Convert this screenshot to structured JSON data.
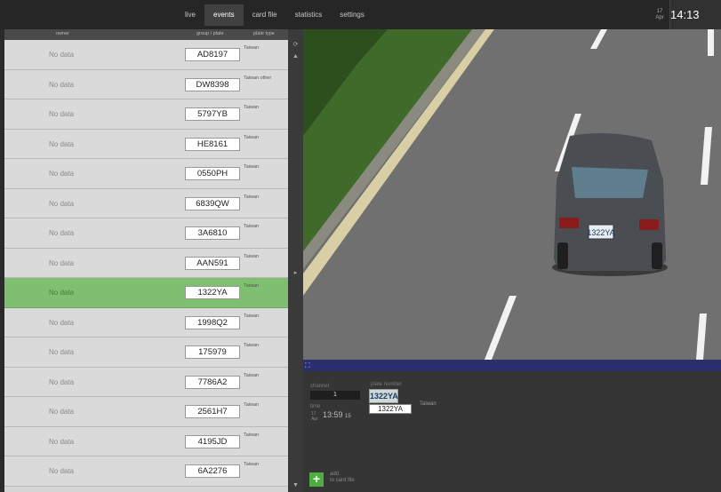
{
  "nav": {
    "tabs": [
      {
        "label": "live",
        "active": false
      },
      {
        "label": "events",
        "active": true
      },
      {
        "label": "card file",
        "active": false
      },
      {
        "label": "statistics",
        "active": false
      },
      {
        "label": "settings",
        "active": false
      }
    ]
  },
  "clock": {
    "day": "17",
    "month": "Apr",
    "time": "14:13"
  },
  "table": {
    "headers": {
      "owner": "owner",
      "group": "group / plate",
      "type": "plate type"
    },
    "rows": [
      {
        "owner": "No data",
        "plate": "AD8197",
        "type": "Taiwan",
        "selected": false
      },
      {
        "owner": "No data",
        "plate": "DW8398",
        "type": "Taiwan other",
        "selected": false
      },
      {
        "owner": "No data",
        "plate": "5797YB",
        "type": "Taiwan",
        "selected": false
      },
      {
        "owner": "No data",
        "plate": "HE8161",
        "type": "Taiwan",
        "selected": false
      },
      {
        "owner": "No data",
        "plate": "0550PH",
        "type": "Taiwan",
        "selected": false
      },
      {
        "owner": "No data",
        "plate": "6839QW",
        "type": "Taiwan",
        "selected": false
      },
      {
        "owner": "No data",
        "plate": "3A6810",
        "type": "Taiwan",
        "selected": false
      },
      {
        "owner": "No data",
        "plate": "AAN591",
        "type": "Taiwan",
        "selected": false
      },
      {
        "owner": "No data",
        "plate": "1322YA",
        "type": "Taiwan",
        "selected": true
      },
      {
        "owner": "No data",
        "plate": "1998Q2",
        "type": "Taiwan",
        "selected": false
      },
      {
        "owner": "No data",
        "plate": "175979",
        "type": "Taiwan",
        "selected": false
      },
      {
        "owner": "No data",
        "plate": "7786A2",
        "type": "Taiwan",
        "selected": false
      },
      {
        "owner": "No data",
        "plate": "2561H7",
        "type": "Taiwan",
        "selected": false
      },
      {
        "owner": "No data",
        "plate": "4195JD",
        "type": "Taiwan",
        "selected": false
      },
      {
        "owner": "No data",
        "plate": "6A2276",
        "type": "Taiwan",
        "selected": false
      }
    ]
  },
  "details": {
    "channel_label": "channel",
    "channel_value": "1",
    "plate_number_label": "plate number",
    "crop_text": "1322YA",
    "plate_value": "1322YA",
    "country": "Taiwan",
    "time_label": "time",
    "time_day": "17",
    "time_month": "Apr",
    "time_hm": "13:59",
    "time_sec": "15",
    "add_label_line1": "add",
    "add_label_line2": "to card file",
    "add_icon": "plus-icon"
  },
  "colors": {
    "selected_row": "#7fbf70",
    "video_bar": "#2a2f6e",
    "add_button": "#4caf3f"
  }
}
